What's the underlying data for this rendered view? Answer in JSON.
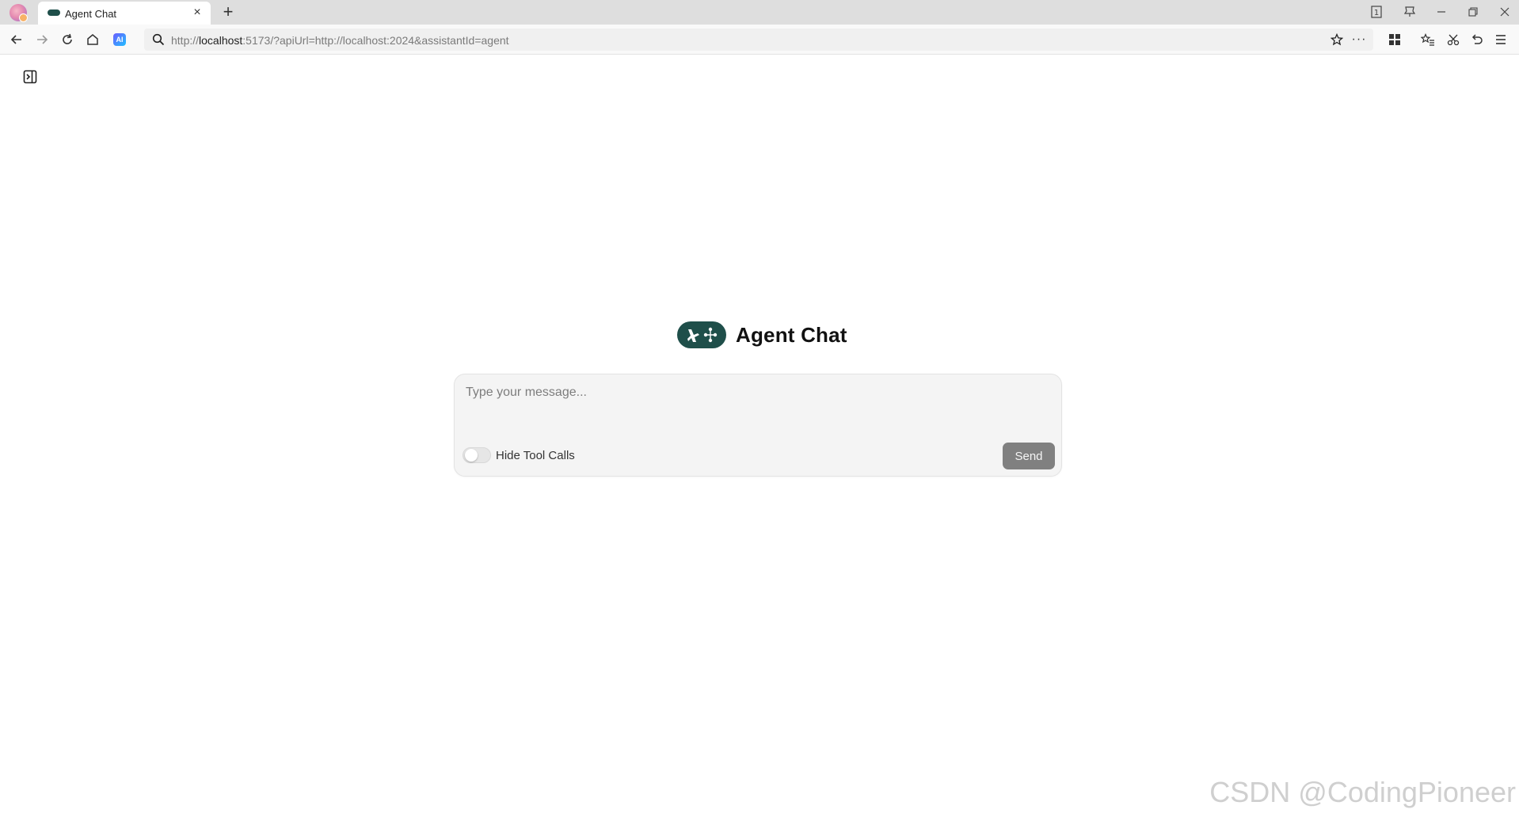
{
  "browser": {
    "tab": {
      "title": "Agent Chat"
    },
    "window_controls": [
      "tab-count-icon",
      "pin-icon",
      "minimize-icon",
      "restore-icon",
      "close-icon"
    ],
    "tab_count": "1",
    "address_bar": {
      "url_prefix": "http://",
      "url_host": "localhost",
      "url_rest": ":5173/?apiUrl=http://localhost:2024&assistantId=agent"
    },
    "ai_badge": "AI"
  },
  "page": {
    "title": "Agent Chat",
    "composer": {
      "placeholder": "Type your message...",
      "value": "",
      "hide_tool_calls_label": "Hide Tool Calls",
      "hide_tool_calls_on": false,
      "send_label": "Send"
    }
  },
  "watermark": "CSDN @CodingPioneer",
  "colors": {
    "brand": "#1f4f4a",
    "send_button": "#808080",
    "composer_bg": "#f4f4f4",
    "tabstrip_bg": "#dedede"
  }
}
